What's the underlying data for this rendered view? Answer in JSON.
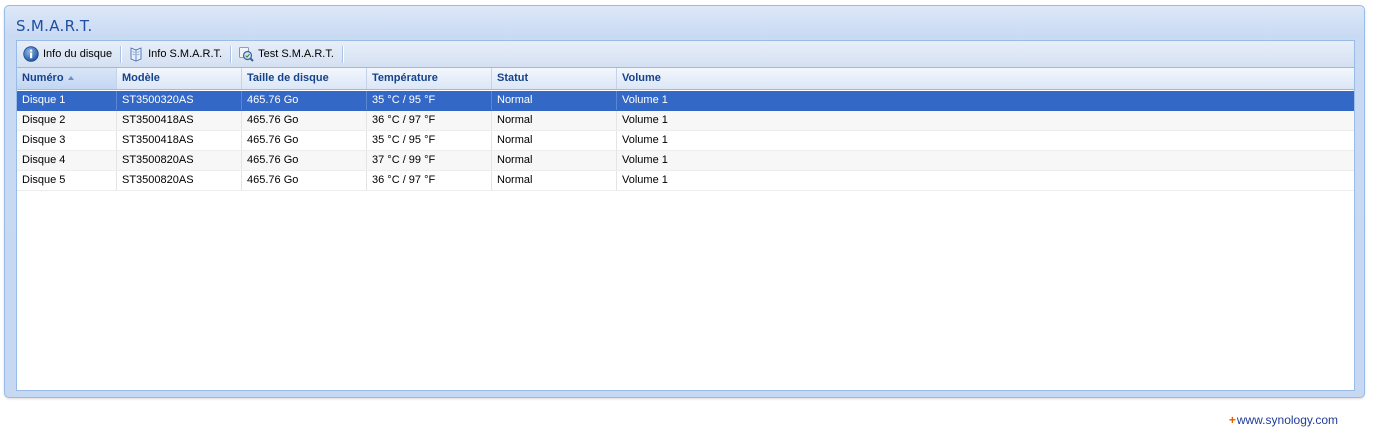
{
  "panel": {
    "title": "S.M.A.R.T."
  },
  "toolbar": {
    "buttons": [
      {
        "label": "Info du disque",
        "icon": "info-icon"
      },
      {
        "label": "Info S.M.A.R.T.",
        "icon": "smart-info-icon"
      },
      {
        "label": "Test S.M.A.R.T.",
        "icon": "smart-test-icon"
      }
    ]
  },
  "grid": {
    "columns": [
      "Numéro",
      "Modèle",
      "Taille de disque",
      "Température",
      "Statut",
      "Volume"
    ],
    "sorted_column": "Numéro",
    "rows": [
      [
        "Disque 1",
        "ST3500320AS",
        "465.76 Go",
        "35 °C / 95 °F",
        "Normal",
        "Volume 1"
      ],
      [
        "Disque 2",
        "ST3500418AS",
        "465.76 Go",
        "36 °C / 97 °F",
        "Normal",
        "Volume 1"
      ],
      [
        "Disque 3",
        "ST3500418AS",
        "465.76 Go",
        "35 °C / 95 °F",
        "Normal",
        "Volume 1"
      ],
      [
        "Disque 4",
        "ST3500820AS",
        "465.76 Go",
        "37 °C / 99 °F",
        "Normal",
        "Volume 1"
      ],
      [
        "Disque 5",
        "ST3500820AS",
        "465.76 Go",
        "36 °C / 97 °F",
        "Normal",
        "Volume 1"
      ]
    ],
    "selected_row": 0
  },
  "footer": {
    "plus": "+",
    "link": "www.synology.com"
  },
  "colors": {
    "selection": "#3368c6",
    "header_text": "#15428b",
    "title_text": "#1f4fa0"
  }
}
